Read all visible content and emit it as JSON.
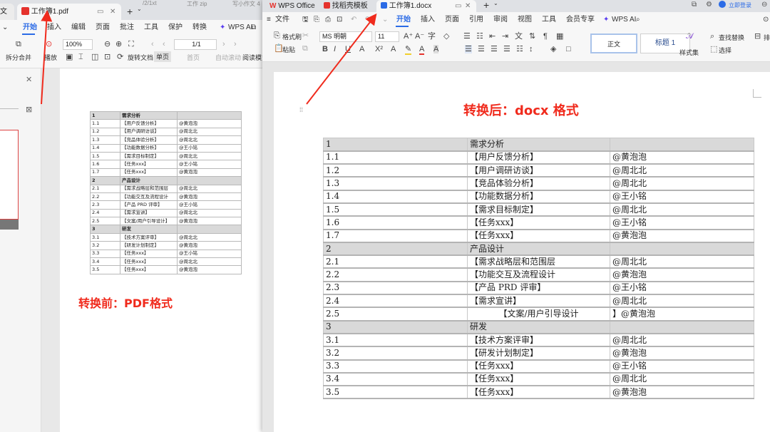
{
  "left_window": {
    "tabs": [
      {
        "label": "文"
      },
      {
        "label": "工作簿1.pdf"
      }
    ],
    "tabbar_extra": "/2/1xt",
    "tabbar_extra2": "工作 zip",
    "tabbar_extra3": "写小作文 4",
    "ribbon_tabs": [
      "开始",
      "插入",
      "编辑",
      "页面",
      "批注",
      "工具",
      "保护",
      "转换"
    ],
    "wps_ai": "WPS AI",
    "toolbar": {
      "split_merge": "拆分合并",
      "rotate_hint": "播放",
      "zoom": "100%",
      "page_value": "1/1",
      "rotate_doc": "旋转文档",
      "single_page": "单页",
      "first_page": "首页",
      "auto_scroll": "自动滚动",
      "read_mode": "阅读模式"
    },
    "table": [
      [
        "1",
        "需求分析",
        ""
      ],
      [
        "1.1",
        "【用户反馈分析】",
        "@黄泡泡"
      ],
      [
        "1.2",
        "【用户调研访谈】",
        "@周北北"
      ],
      [
        "1.3",
        "【竞品体验分析】",
        "@周北北"
      ],
      [
        "1.4",
        "【功能数据分析】",
        "@王小铭"
      ],
      [
        "1.5",
        "【需求目标制定】",
        "@周北北"
      ],
      [
        "1.6",
        "【任务xxx】",
        "@王小铭"
      ],
      [
        "1.7",
        "【任务xxx】",
        "@黄泡泡"
      ],
      [
        "2",
        "产品设计",
        ""
      ],
      [
        "2.1",
        "【需求战略层和范围层",
        "@周北北"
      ],
      [
        "2.2",
        "【功能交互及流程设计",
        "@黄泡泡"
      ],
      [
        "2.3",
        "【产品 PRD 评审】",
        "@王小铭"
      ],
      [
        "2.4",
        "【需求宣讲】",
        "@周北北"
      ],
      [
        "2.5",
        "【文案/用户引导设计】",
        "@黄泡泡"
      ],
      [
        "3",
        "研发",
        ""
      ],
      [
        "3.1",
        "【技术方案评审】",
        "@周北北"
      ],
      [
        "3.2",
        "【研发计划制定】",
        "@黄泡泡"
      ],
      [
        "3.3",
        "【任务xxx】",
        "@王小铭"
      ],
      [
        "3.4",
        "【任务xxx】",
        "@周北北"
      ],
      [
        "3.5",
        "【任务xxx】",
        "@黄泡泡"
      ]
    ],
    "label_before": "转换前：PDF格式"
  },
  "right_window": {
    "tabs": [
      {
        "label": "WPS Office"
      },
      {
        "label": "找稻壳模板"
      },
      {
        "label": "工作簿1.docx"
      }
    ],
    "login": "立即登录",
    "ribbon_tabs": [
      "文件",
      "开始",
      "插入",
      "页面",
      "引用",
      "审阅",
      "视图",
      "工具",
      "会员专享"
    ],
    "wps_ai": "WPS AI",
    "toolbar": {
      "format_painter": "格式刷",
      "paste": "粘贴",
      "font_name": "MS 明朝",
      "font_size": "11",
      "style_normal": "正文",
      "style_heading1": "标题 1",
      "style_set": "样式集",
      "find_replace": "查找替换",
      "select": "选择",
      "more": "排"
    },
    "label_after": "转换后：docx 格式",
    "table": [
      [
        "1",
        "需求分析",
        ""
      ],
      [
        "1.1",
        "【用户反馈分析】",
        "@黄泡泡"
      ],
      [
        "1.2",
        "【用户调研访谈】",
        "@周北北"
      ],
      [
        "1.3",
        "【竞品体验分析】",
        "@周北北"
      ],
      [
        "1.4",
        "【功能数据分析】",
        "@王小铭"
      ],
      [
        "1.5",
        "【需求目标制定】",
        "@周北北"
      ],
      [
        "1.6",
        "【任务xxx】",
        "@王小铭"
      ],
      [
        "1.7",
        "【任务xxx】",
        "@黄泡泡"
      ],
      [
        "2",
        "产品设计",
        ""
      ],
      [
        "2.1",
        "【需求战略层和范围层",
        "@周北北"
      ],
      [
        "2.2",
        "【功能交互及流程设计",
        "@黄泡泡"
      ],
      [
        "2.3",
        "【产品 PRD 评审】",
        "@王小铭"
      ],
      [
        "2.4",
        "【需求宣讲】",
        "@周北北"
      ],
      [
        "2.5",
        "【文案/用户引导设计",
        "】@黄泡泡"
      ],
      [
        "3",
        "研发",
        ""
      ],
      [
        "3.1",
        "【技术方案评审】",
        "@周北北"
      ],
      [
        "3.2",
        "【研发计划制定】",
        "@黄泡泡"
      ],
      [
        "3.3",
        "【任务xxx】",
        "@王小铭"
      ],
      [
        "3.4",
        "【任务xxx】",
        "@周北北"
      ],
      [
        "3.5",
        "【任务xxx】",
        "@黄泡泡"
      ]
    ]
  },
  "colors": {
    "accent_red": "#f02b1d",
    "wps_red": "#e5322d",
    "word_blue": "#2b6be6",
    "header_gray": "#d9d9d9"
  }
}
